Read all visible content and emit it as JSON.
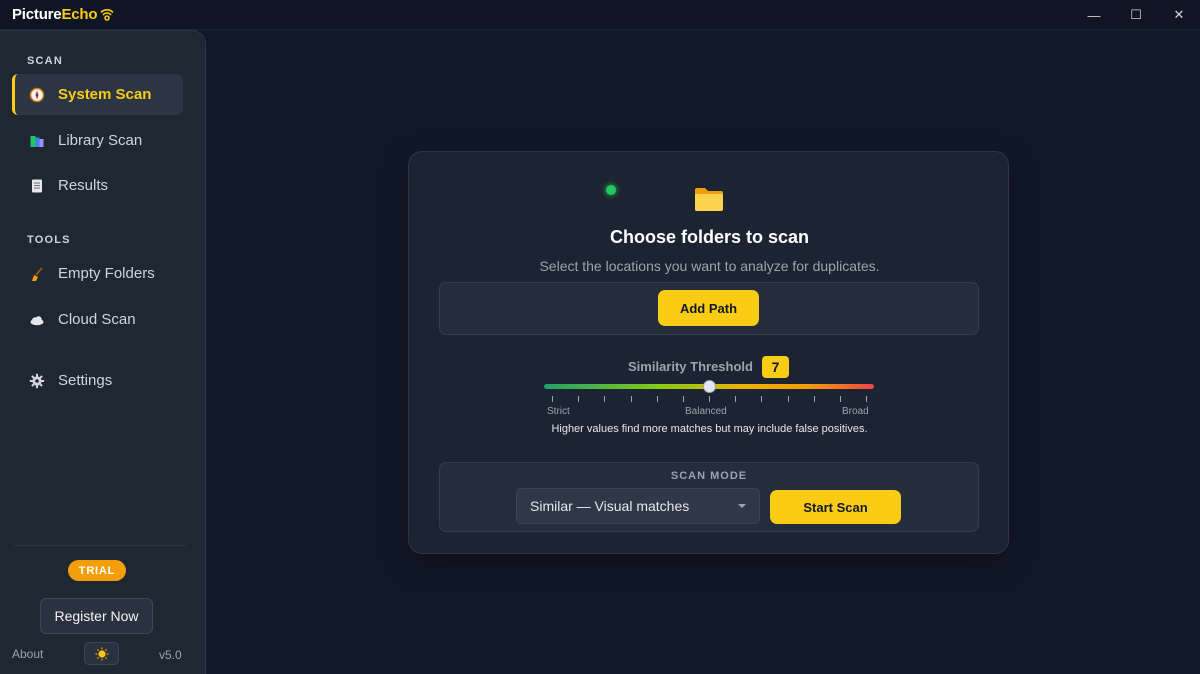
{
  "app": {
    "title_part1": "Picture",
    "title_part2": "Echo",
    "logo_icon": "signal-waves-icon"
  },
  "window_controls": {
    "minimize": "—",
    "maximize": "☐",
    "close": "✕"
  },
  "sidebar": {
    "scan_section": "SCAN",
    "tools_section": "TOOLS",
    "items": [
      {
        "label": "System Scan",
        "icon": "compass-icon",
        "active": true
      },
      {
        "label": "Library Scan",
        "icon": "books-icon",
        "active": false
      },
      {
        "label": "Results",
        "icon": "document-icon",
        "active": false
      },
      {
        "label": "Empty Folders",
        "icon": "broom-icon",
        "active": false
      },
      {
        "label": "Cloud Scan",
        "icon": "cloud-icon",
        "active": false
      },
      {
        "label": "Settings",
        "icon": "gear-icon",
        "active": false
      }
    ],
    "trial_badge": "TRIAL",
    "register_label": "Register Now",
    "about_label": "About",
    "theme_icon": "sun-icon",
    "version": "v5.0"
  },
  "main": {
    "status": "online",
    "title": "Choose folders to scan",
    "subtitle": "Select the locations you want to analyze for duplicates.",
    "add_path_label": "Add Path",
    "threshold": {
      "label": "Similarity Threshold",
      "value": "7",
      "min": 0,
      "max": 12,
      "current": 6,
      "left_label": "Strict",
      "mid_label": "Balanced",
      "right_label": "Broad",
      "hint": "Higher values find more matches but may include false positives."
    },
    "scan_mode": {
      "label": "SCAN MODE",
      "selected": "Similar — Visual matches"
    },
    "start_label": "Start Scan"
  },
  "colors": {
    "accent": "#facc15",
    "trial": "#f59e0b",
    "status_online": "#22c55e",
    "background": "#111827",
    "panel": "#1c2432"
  }
}
